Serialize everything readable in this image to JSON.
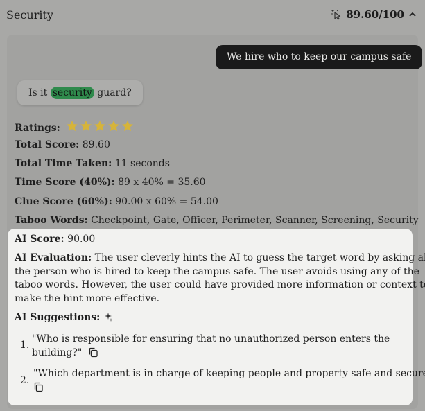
{
  "header": {
    "title": "Security",
    "score": "89.60/100"
  },
  "chat": {
    "user_message": "We hire who to keep our campus safe",
    "ai_prefix": "Is it",
    "ai_highlight": "security",
    "ai_suffix": "guard?"
  },
  "stats": {
    "ratings_label": "Ratings:",
    "ratings_value": 5,
    "total_score_label": "Total Score:",
    "total_score": "89.60",
    "time_taken_label": "Total Time Taken:",
    "time_taken": "11 seconds",
    "time_score_label": "Time Score (40%):",
    "time_score": "89 x 40% = 35.60",
    "clue_score_label": "Clue Score (60%):",
    "clue_score": "90.00 x 60% = 54.00",
    "taboo_label": "Taboo Words:",
    "taboo_words": "Checkpoint, Gate, Officer, Perimeter, Scanner, Screening, Security"
  },
  "ai_card": {
    "score_label": "AI Score:",
    "score": "90.00",
    "evaluation_label": "AI Evaluation:",
    "evaluation_line1": "The user cleverly hints the AI to guess the target word by asking about",
    "evaluation_line2": "the person who is hired to keep the campus safe. The user avoids using any of the",
    "evaluation_line3": "taboo words. However, the user could have provided more information or context to",
    "evaluation_line4": "make the hint more effective.",
    "suggestions_label": "AI Suggestions:",
    "suggestions": [
      {
        "num": "1.",
        "line1": "\"Who is responsible for ensuring that no unauthorized person enters the",
        "line2": "building?\""
      },
      {
        "num": "2.",
        "line1": "\"Which department is in charge of keeping people and property safe and secure?\"",
        "line2": ""
      }
    ]
  },
  "colors": {
    "background": "#a8a8a6",
    "card": "#f2f2f0",
    "user_bubble": "#1a1a1a",
    "highlight": "#2f8a4c",
    "star": "#d6b43a"
  }
}
